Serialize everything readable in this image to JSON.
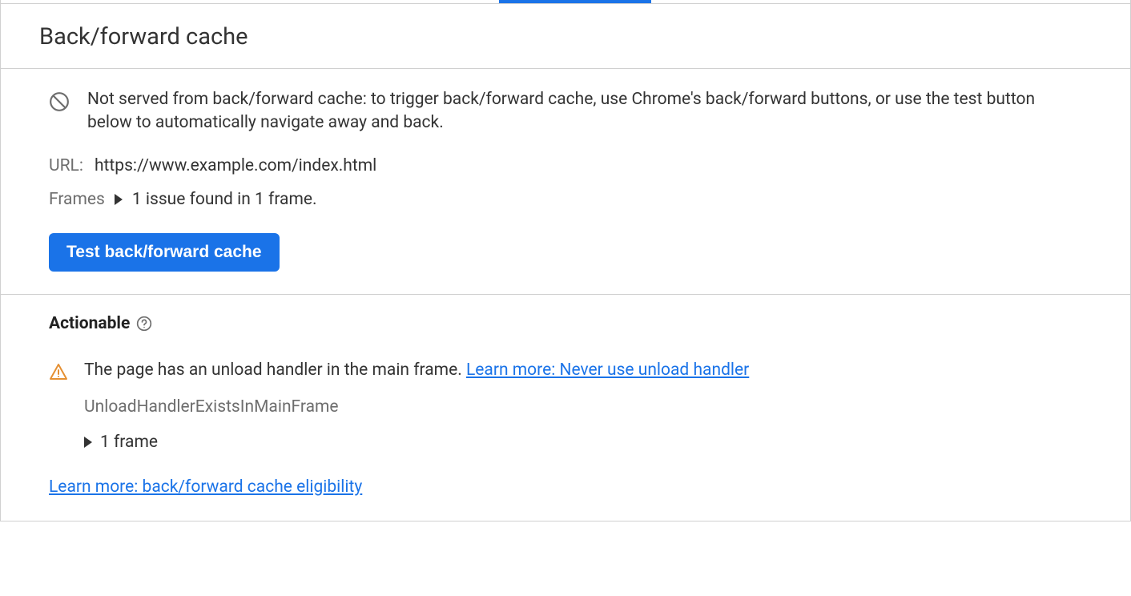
{
  "header": {
    "title": "Back/forward cache"
  },
  "info": {
    "message": "Not served from back/forward cache: to trigger back/forward cache, use Chrome's back/forward buttons, or use the test button below to automatically navigate away and back.",
    "url_label": "URL:",
    "url_value": "https://www.example.com/index.html",
    "frames_label": "Frames",
    "frames_summary": "1 issue found in 1 frame.",
    "test_button": "Test back/forward cache"
  },
  "actionable": {
    "heading": "Actionable",
    "issue_text": "The page has an unload handler in the main frame. ",
    "issue_link": "Learn more: Never use unload handler",
    "issue_code": "UnloadHandlerExistsInMainFrame",
    "frame_count": "1 frame",
    "eligibility_link": "Learn more: back/forward cache eligibility"
  }
}
